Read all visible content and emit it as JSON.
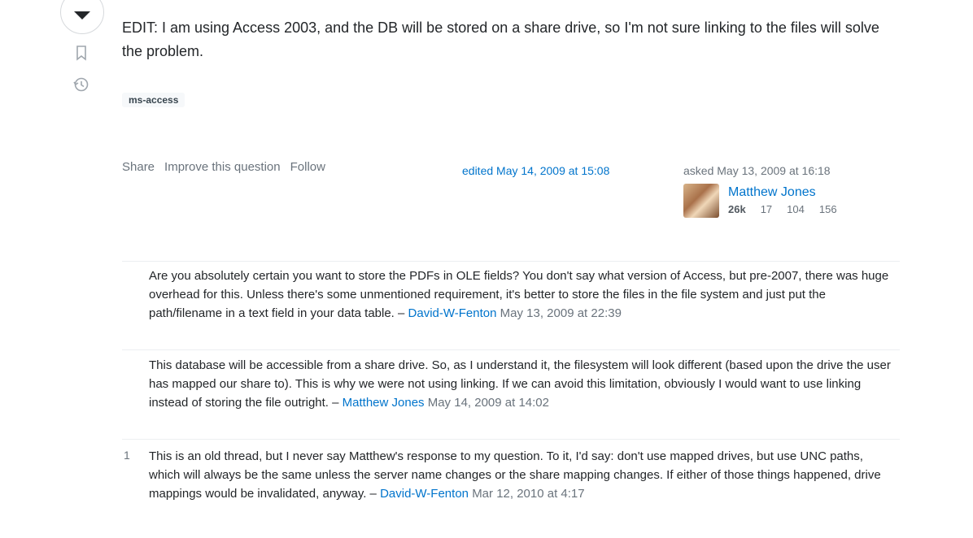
{
  "post": {
    "text": "EDIT: I am using Access 2003, and the DB will be stored on a share drive, so I'm not sure linking to the files will solve the problem.",
    "tag": "ms-access"
  },
  "menu": {
    "share": "Share",
    "improve": "Improve this question",
    "follow": "Follow"
  },
  "meta": {
    "edited": "edited May 14, 2009 at 15:08",
    "asked": "asked May 13, 2009 at 16:18"
  },
  "user": {
    "name": "Matthew Jones",
    "reputation": "26k",
    "gold": "17",
    "silver": "104",
    "bronze": "156"
  },
  "comments": [
    {
      "score": "",
      "text": "Are you absolutely certain you want to store the PDFs in OLE fields? You don't say what version of Access, but pre-2007, there was huge overhead for this. Unless there's some unmentioned requirement, it's better to store the files in the file system and just put the path/filename in a text field in your data table. –",
      "author": "David-W-Fenton",
      "date": "May 13, 2009 at 22:39"
    },
    {
      "score": "",
      "text": "This database will be accessible from a share drive. So, as I understand it, the filesystem will look different (based upon the drive the user has mapped our share to). This is why we were not using linking. If we can avoid this limitation, obviously I would want to use linking instead of storing the file outright. –",
      "author": "Matthew Jones",
      "date": "May 14, 2009 at 14:02"
    },
    {
      "score": "1",
      "text": "This is an old thread, but I never say Matthew's response to my question. To it, I'd say: don't use mapped drives, but use UNC paths, which will always be the same unless the server name changes or the share mapping changes. If either of those things happened, drive mappings would be invalidated, anyway. –",
      "author": "David-W-Fenton",
      "date": "Mar 12, 2010 at 4:17"
    }
  ]
}
